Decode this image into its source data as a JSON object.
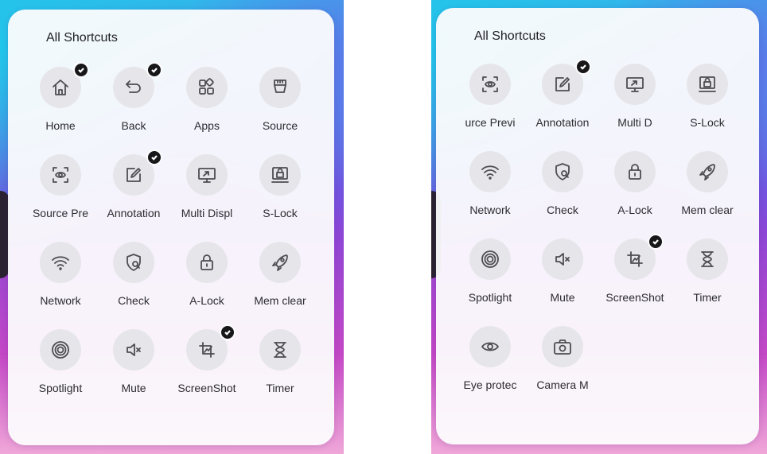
{
  "left_panel": {
    "title": "All Shortcuts",
    "items": [
      {
        "label": "Home",
        "icon": "home-icon",
        "checked": true
      },
      {
        "label": "Back",
        "icon": "back-icon",
        "checked": true
      },
      {
        "label": "Apps",
        "icon": "apps-icon",
        "checked": false
      },
      {
        "label": "Source",
        "icon": "source-icon",
        "checked": false
      },
      {
        "label": "Source Pre",
        "icon": "source-preview-icon",
        "checked": false
      },
      {
        "label": "Annotation",
        "icon": "annotation-icon",
        "checked": true
      },
      {
        "label": "Multi Displ",
        "icon": "multi-display-icon",
        "checked": false
      },
      {
        "label": "S-Lock",
        "icon": "screen-lock-icon",
        "checked": false
      },
      {
        "label": "Network",
        "icon": "wifi-icon",
        "checked": false
      },
      {
        "label": "Check",
        "icon": "check-shield-icon",
        "checked": false
      },
      {
        "label": "A-Lock",
        "icon": "padlock-icon",
        "checked": false
      },
      {
        "label": "Mem clear",
        "icon": "rocket-icon",
        "checked": false
      },
      {
        "label": "Spotlight",
        "icon": "spotlight-icon",
        "checked": false
      },
      {
        "label": "Mute",
        "icon": "mute-icon",
        "checked": false
      },
      {
        "label": "ScreenShot",
        "icon": "screenshot-icon",
        "checked": true
      },
      {
        "label": "Timer",
        "icon": "hourglass-icon",
        "checked": false
      }
    ]
  },
  "right_panel": {
    "title": "All Shortcuts",
    "items": [
      {
        "label": "urce Previ",
        "icon": "source-preview-icon",
        "checked": false
      },
      {
        "label": "Annotation",
        "icon": "annotation-icon",
        "checked": true
      },
      {
        "label": "Multi D",
        "icon": "multi-display-icon",
        "checked": false
      },
      {
        "label": "S-Lock",
        "icon": "screen-lock-icon",
        "checked": false
      },
      {
        "label": "Network",
        "icon": "wifi-icon",
        "checked": false
      },
      {
        "label": "Check",
        "icon": "check-shield-icon",
        "checked": false
      },
      {
        "label": "A-Lock",
        "icon": "padlock-icon",
        "checked": false
      },
      {
        "label": "Mem clear",
        "icon": "rocket-icon",
        "checked": false
      },
      {
        "label": "Spotlight",
        "icon": "spotlight-icon",
        "checked": false
      },
      {
        "label": "Mute",
        "icon": "mute-icon",
        "checked": false
      },
      {
        "label": "ScreenShot",
        "icon": "screenshot-icon",
        "checked": true
      },
      {
        "label": "Timer",
        "icon": "hourglass-icon",
        "checked": false
      },
      {
        "label": "Eye protec",
        "icon": "eye-icon",
        "checked": false
      },
      {
        "label": "Camera M",
        "icon": "camera-icon",
        "checked": false
      }
    ]
  }
}
